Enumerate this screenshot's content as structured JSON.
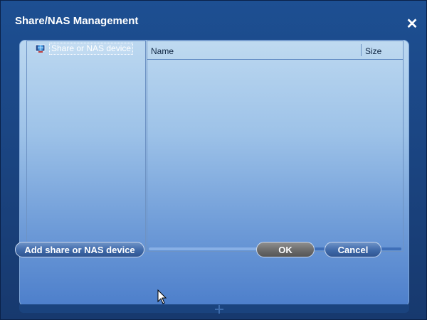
{
  "window": {
    "title": "Share/NAS Management"
  },
  "tree": {
    "items": [
      {
        "label": "Share or NAS device",
        "icon": "network-globe-icon"
      }
    ]
  },
  "list": {
    "columns": [
      {
        "label": "Name"
      },
      {
        "label": "Size"
      }
    ],
    "rows": []
  },
  "buttons": {
    "add_label": "Add share or NAS device",
    "ok_label": "OK",
    "cancel_label": "Cancel"
  },
  "colors": {
    "window_bg": "#1b4684",
    "panel_top": "#bcd8f0",
    "panel_bottom": "#4d7fcb",
    "ok_button": "#6b6b6b"
  }
}
